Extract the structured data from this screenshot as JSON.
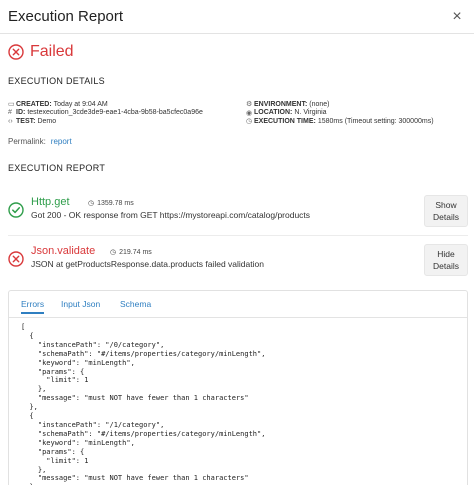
{
  "header": {
    "title": "Execution Report",
    "close_symbol": "×"
  },
  "status": {
    "label": "Failed",
    "color": "#d9383a"
  },
  "sections": {
    "details_title": "EXECUTION DETAILS",
    "report_title": "EXECUTION REPORT"
  },
  "details": {
    "created_key": "CREATED:",
    "created_val": "Today at 9:04 AM",
    "id_key": "ID:",
    "id_val": "testexecution_3cde3de9-eae1-4cba-9b58-ba5cfec0a96e",
    "test_key": "TEST:",
    "test_val": "Demo",
    "env_key": "ENVIRONMENT:",
    "env_val": "(none)",
    "loc_key": "LOCATION:",
    "loc_val": "N. Virginia",
    "exec_key": "EXECUTION TIME:",
    "exec_val": "1580ms (Timeout setting: 300000ms)"
  },
  "permalink": {
    "label": "Permalink:",
    "link": "report"
  },
  "steps": [
    {
      "name": "Http.get",
      "time": "1359.78 ms",
      "message": "Got 200 - OK response from GET https://mystoreapi.com/catalog/products",
      "button_line1": "Show",
      "button_line2": "Details",
      "color": "#2e9d4a"
    },
    {
      "name": "Json.validate",
      "time": "219.74 ms",
      "message": "JSON at getProductsResponse.data.products failed validation",
      "button_line1": "Hide",
      "button_line2": "Details",
      "color": "#d9383a"
    }
  ],
  "tabs": [
    "Errors",
    "Input Json",
    "Schema"
  ],
  "code": "[\n  {\n    \"instancePath\": \"/0/category\",\n    \"schemaPath\": \"#/items/properties/category/minLength\",\n    \"keyword\": \"minLength\",\n    \"params\": {\n      \"limit\": 1\n    },\n    \"message\": \"must NOT have fewer than 1 characters\"\n  },\n  {\n    \"instancePath\": \"/1/category\",\n    \"schemaPath\": \"#/items/properties/category/minLength\",\n    \"keyword\": \"minLength\",\n    \"params\": {\n      \"limit\": 1\n    },\n    \"message\": \"must NOT have fewer than 1 characters\"\n  },"
}
